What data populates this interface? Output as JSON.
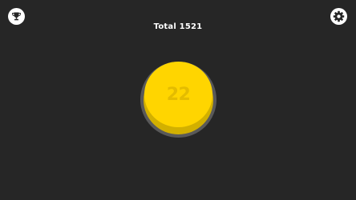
{
  "header": {
    "total_label": "Total 1521"
  },
  "buttons": {
    "left_icon": "trophy-icon",
    "right_icon": "gear-icon"
  },
  "tap_button": {
    "count": "22"
  },
  "colors": {
    "background": "#262626",
    "accent": "#ffd500",
    "accent_shadow": "#d2b000",
    "count_text": "#e4bc00",
    "ring": "#595959"
  }
}
